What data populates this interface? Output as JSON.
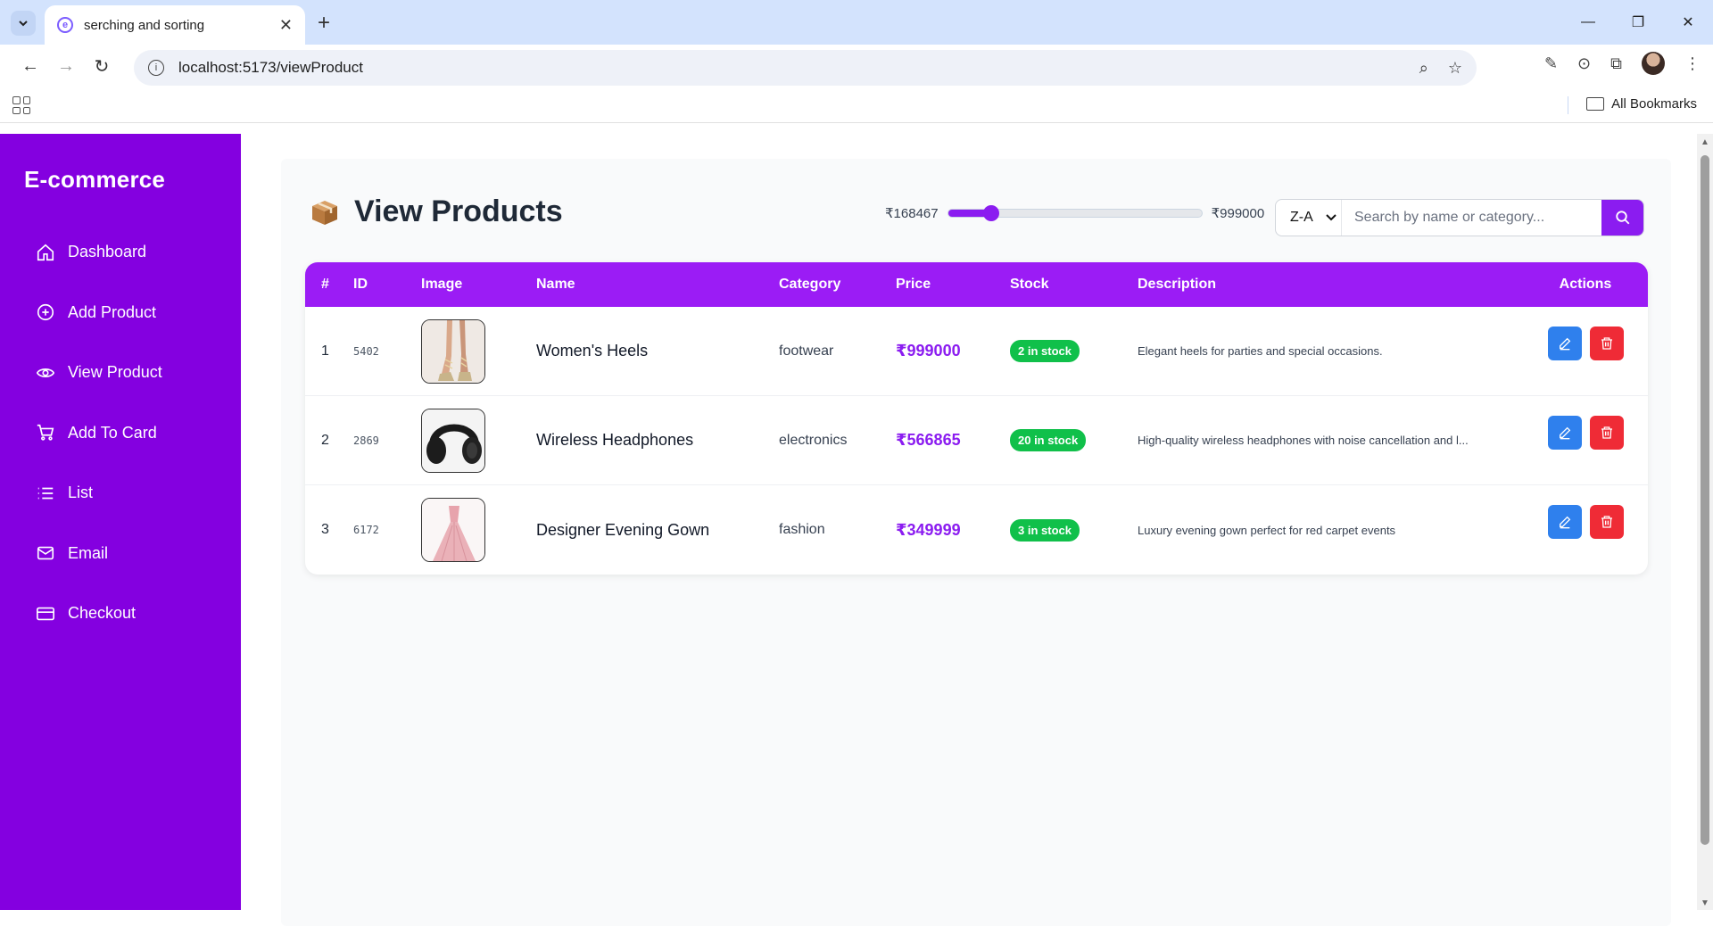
{
  "browser": {
    "tab_title": "serching and sorting",
    "url": "localhost:5173/viewProduct",
    "all_bookmarks": "All Bookmarks"
  },
  "sidebar": {
    "brand": "E-commerce",
    "items": [
      {
        "label": "Dashboard",
        "icon": "home-icon"
      },
      {
        "label": "Add Product",
        "icon": "plus-circle-icon"
      },
      {
        "label": "View Product",
        "icon": "eye-icon"
      },
      {
        "label": "Add To Card",
        "icon": "cart-icon"
      },
      {
        "label": "List",
        "icon": "list-icon"
      },
      {
        "label": "Email",
        "icon": "mail-icon"
      },
      {
        "label": "Checkout",
        "icon": "credit-card-icon"
      }
    ]
  },
  "page": {
    "title": "View Products",
    "title_icon": "package-icon"
  },
  "price_filter": {
    "min_label": "₹168467",
    "max_label": "₹999000",
    "min": 0,
    "max": 999000,
    "value": 168467
  },
  "sort": {
    "selected": "Z-A"
  },
  "search": {
    "placeholder": "Search by name or category...",
    "value": ""
  },
  "table": {
    "headers": {
      "num": "#",
      "id": "ID",
      "image": "Image",
      "name": "Name",
      "category": "Category",
      "price": "Price",
      "stock": "Stock",
      "description": "Description",
      "actions": "Actions"
    },
    "rows": [
      {
        "num": "1",
        "id": "5402",
        "name": "Women's Heels",
        "category": "footwear",
        "price": "₹999000",
        "stock": "2 in stock",
        "description": "Elegant heels for parties and special occasions.",
        "image": "heels"
      },
      {
        "num": "2",
        "id": "2869",
        "name": "Wireless Headphones",
        "category": "electronics",
        "price": "₹566865",
        "stock": "20 in stock",
        "description": "High-quality wireless headphones with noise cancellation and l...",
        "image": "headphones"
      },
      {
        "num": "3",
        "id": "6172",
        "name": "Designer Evening Gown",
        "category": "fashion",
        "price": "₹349999",
        "stock": "3 in stock",
        "description": "Luxury evening gown perfect for red carpet events",
        "image": "gown"
      }
    ]
  },
  "colors": {
    "sidebar": "#8400e0",
    "accent": "#9b1cf5",
    "price": "#8b1cf0",
    "stock_badge": "#10c04a",
    "edit_button": "#2f80ed",
    "delete_button": "#ef2b36"
  }
}
